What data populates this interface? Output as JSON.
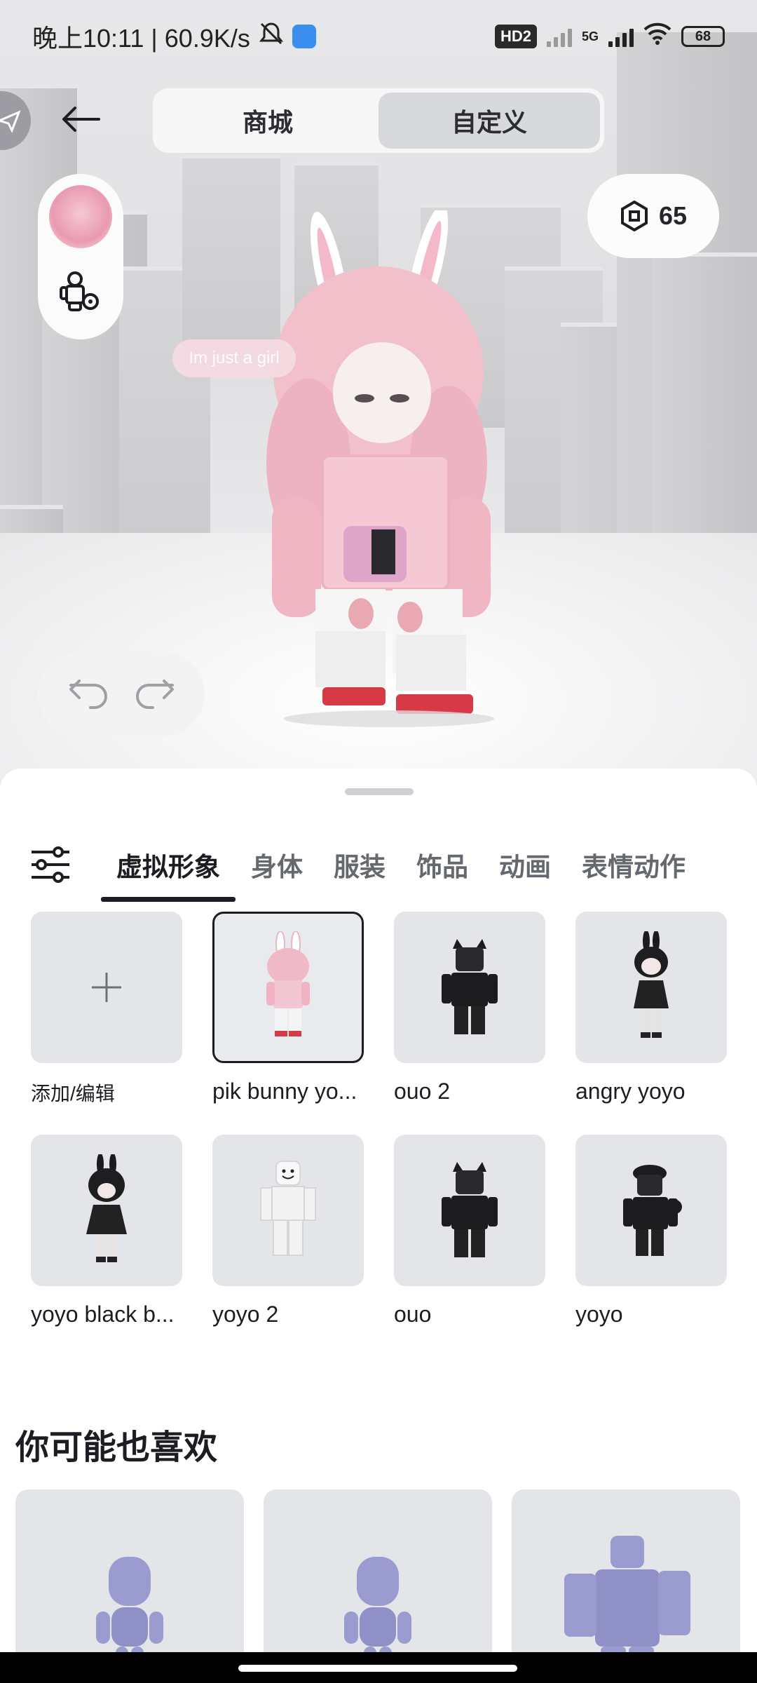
{
  "status_bar": {
    "time_speed": "晚上10:11 | 60.9K/s",
    "hd_label": "HD2",
    "net_label": "5G",
    "battery": "68"
  },
  "header": {
    "tabs": [
      {
        "label": "商城",
        "active": false
      },
      {
        "label": "自定义",
        "active": true
      }
    ]
  },
  "currency": {
    "icon": "robux-icon",
    "amount": "65"
  },
  "scene": {
    "chat_bubble": "Im just a girl"
  },
  "category_tabs": [
    {
      "label": "虚拟形象",
      "active": true
    },
    {
      "label": "身体",
      "active": false
    },
    {
      "label": "服装",
      "active": false
    },
    {
      "label": "饰品",
      "active": false
    },
    {
      "label": "动画",
      "active": false
    },
    {
      "label": "表情动作",
      "active": false
    }
  ],
  "outfits": [
    {
      "label": "添加/编辑",
      "type": "add"
    },
    {
      "label": "pik bunny yo...",
      "type": "outfit",
      "selected": true,
      "style": "pink"
    },
    {
      "label": "ouo 2",
      "type": "outfit",
      "style": "black"
    },
    {
      "label": "angry yoyo",
      "type": "outfit",
      "style": "blackdress"
    },
    {
      "label": "yoyo black b...",
      "type": "outfit",
      "style": "blackdress"
    },
    {
      "label": "yoyo 2",
      "type": "outfit",
      "style": "white"
    },
    {
      "label": "ouo",
      "type": "outfit",
      "style": "black"
    },
    {
      "label": "yoyo",
      "type": "outfit",
      "style": "black"
    }
  ],
  "recommendations": {
    "title": "你可能也喜欢",
    "accent_color": "#9a9ccf"
  }
}
